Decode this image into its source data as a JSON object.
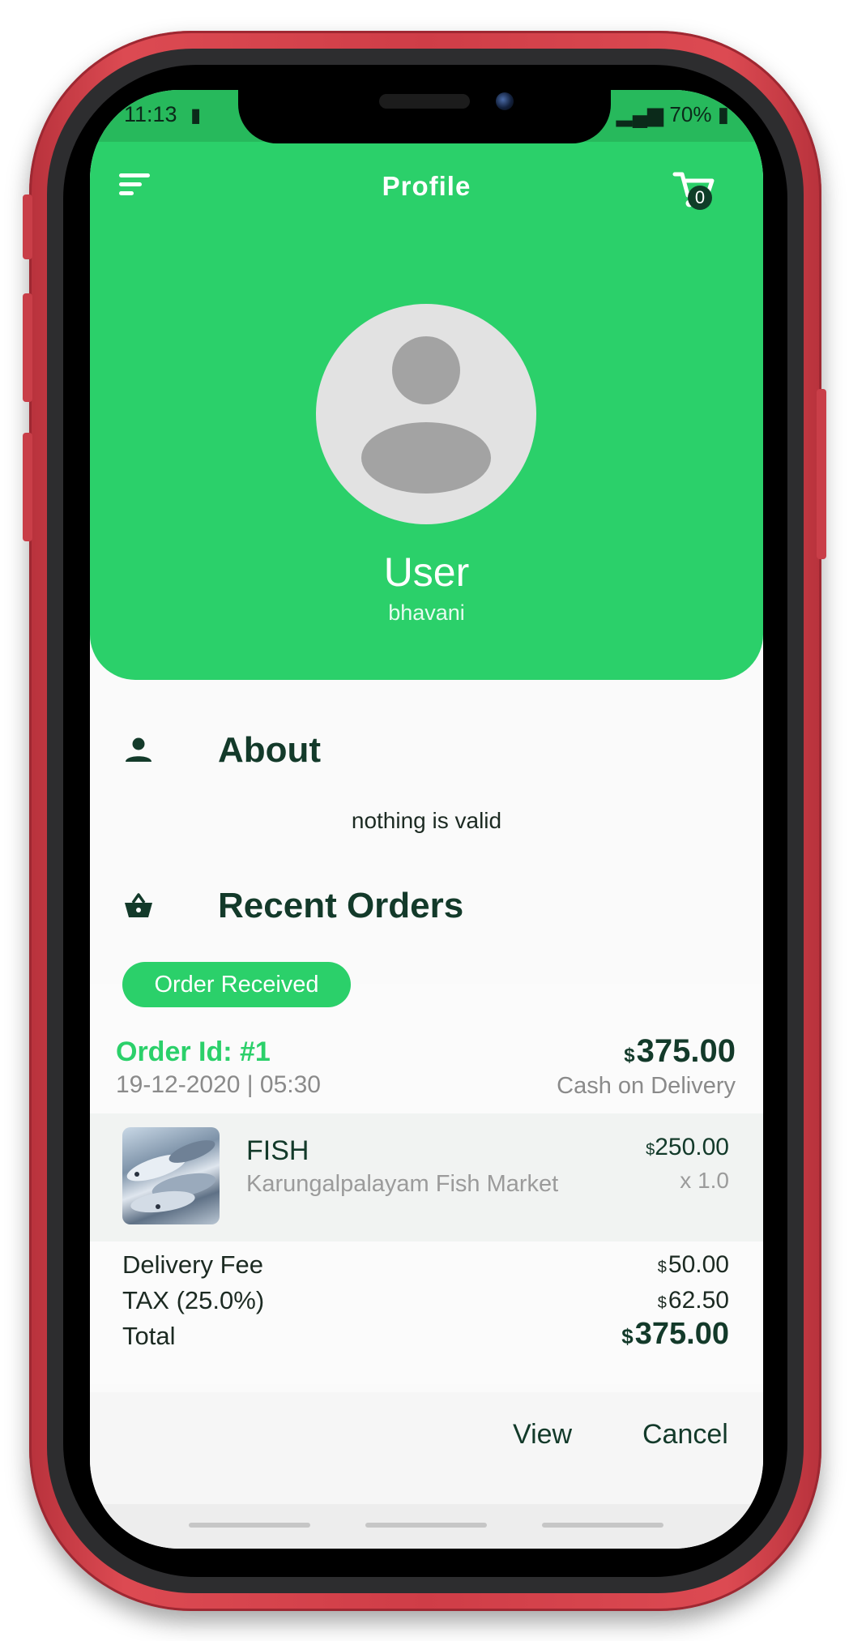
{
  "status_bar": {
    "time": "11:13",
    "battery": "70%"
  },
  "header": {
    "title": "Profile",
    "cart_count": "0"
  },
  "profile": {
    "name": "User",
    "username": "bhavani"
  },
  "about": {
    "heading": "About",
    "text": "nothing is valid"
  },
  "orders": {
    "heading": "Recent Orders",
    "status": "Order Received",
    "order_id": "Order Id: #1",
    "date": "19-12-2020 | 05:30",
    "currency": "$",
    "amount": "375.00",
    "payment": "Cash on Delivery",
    "item": {
      "name": "FISH",
      "store": "Karungalpalayam Fish Market",
      "price": "250.00",
      "qty": "x 1.0"
    },
    "fees": [
      {
        "label": "Delivery Fee",
        "value": "50.00"
      },
      {
        "label": "TAX (25.0%)",
        "value": "62.50"
      },
      {
        "label": "Total",
        "value": "375.00"
      }
    ],
    "actions": {
      "view": "View",
      "cancel": "Cancel"
    }
  },
  "colors": {
    "accent": "#2bd06a",
    "dark_text": "#133a2a",
    "frame": "#cf3d47"
  }
}
